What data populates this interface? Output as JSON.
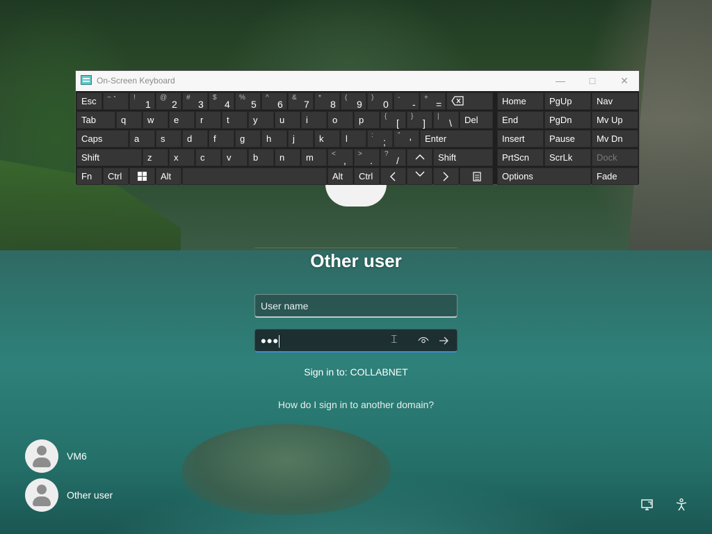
{
  "login": {
    "title": "Other user",
    "username_placeholder": "User name",
    "password_mask": "•••",
    "sign_in_to": "Sign in to: COLLABNET",
    "other_domain_link": "How do I sign in to another domain?"
  },
  "users": [
    {
      "name": "VM6"
    },
    {
      "name": "Other user"
    }
  ],
  "osk": {
    "title": "On-Screen Keyboard",
    "row1": {
      "esc": "Esc",
      "k1": {
        "sub": "! ",
        "main": "1"
      },
      "k2": {
        "sub": "@",
        "main": "2"
      },
      "k3": {
        "sub": "#",
        "main": "3"
      },
      "k4": {
        "sub": "$",
        "main": "4"
      },
      "k5": {
        "sub": "%",
        "main": "5"
      },
      "k6": {
        "sub": "^",
        "main": "6"
      },
      "k7": {
        "sub": "&",
        "main": "7"
      },
      "k8": {
        "sub": "*",
        "main": "8"
      },
      "k9": {
        "sub": "(",
        "main": "9"
      },
      "k0": {
        "sub": ")",
        "main": "0"
      },
      "minus": {
        "sub": "-",
        "main": "-"
      },
      "equals": {
        "sub": "+",
        "main": "="
      },
      "tilde": {
        "sub": "~",
        "main": "`"
      }
    },
    "row2": [
      "Tab",
      "q",
      "w",
      "e",
      "r",
      "t",
      "y",
      "u",
      "i",
      "o",
      "p",
      "Del"
    ],
    "row2_brackets": [
      {
        "sub": "{",
        "main": "["
      },
      {
        "sub": "}",
        "main": "]"
      },
      {
        "sub": "|",
        "main": "\\"
      }
    ],
    "row3": [
      "Caps",
      "a",
      "s",
      "d",
      "f",
      "g",
      "h",
      "j",
      "k",
      "l",
      "Enter"
    ],
    "row3_punct": [
      {
        "sub": ":",
        "main": ";"
      },
      {
        "sub": "\"",
        "main": "'"
      }
    ],
    "row4": [
      "Shift",
      "z",
      "x",
      "c",
      "v",
      "b",
      "n",
      "m",
      "Shift"
    ],
    "row4_punct": [
      {
        "sub": "<",
        "main": ","
      },
      {
        "sub": ">",
        "main": "."
      },
      {
        "sub": "?",
        "main": "/"
      }
    ],
    "row5": [
      "Fn",
      "Ctrl",
      "Alt",
      "Alt",
      "Ctrl"
    ],
    "nav": [
      "Home",
      "PgUp",
      "Nav",
      "End",
      "PgDn",
      "Mv Up",
      "Insert",
      "Pause",
      "Mv Dn",
      "PrtScn",
      "ScrLk",
      "Dock",
      "Options",
      "Fade"
    ]
  }
}
